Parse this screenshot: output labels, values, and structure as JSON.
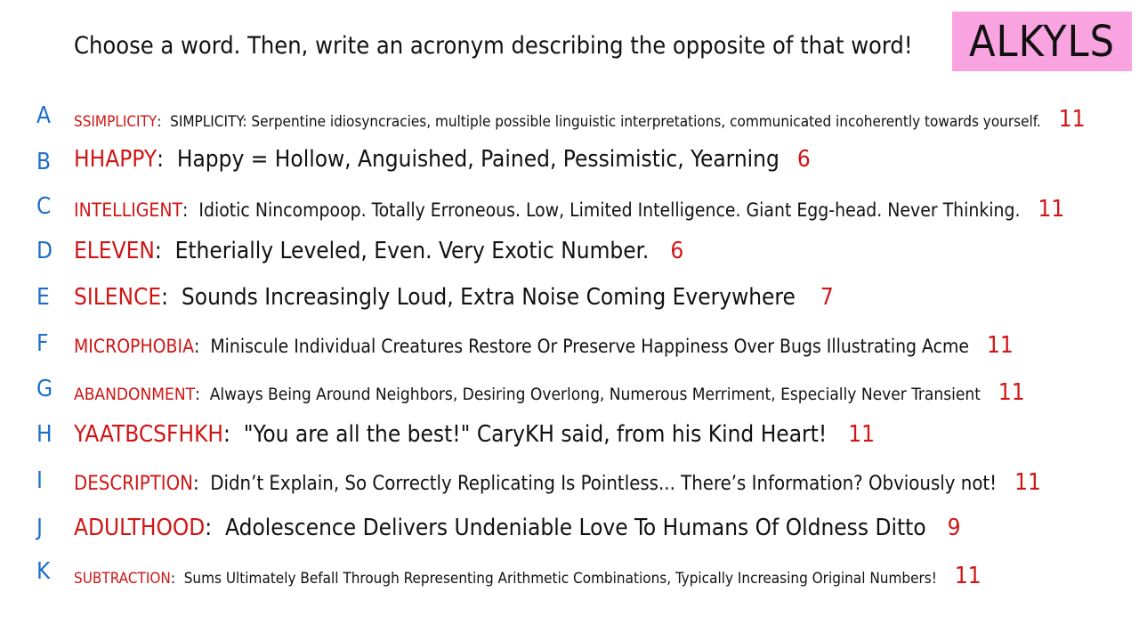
{
  "prompt": "Choose a word. Then, write an acronym describing the opposite of that word!",
  "badge": "ALKYLS",
  "entries": [
    {
      "letter": "A",
      "word": "SSIMPLICITY",
      "definition": "SIMPLICITY: Serpentine idiosyncracies, multiple possible linguistic interpretations, communicated incoherently towards yourself.",
      "count": "11"
    },
    {
      "letter": "B",
      "word": "HHAPPY",
      "definition": "Happy = Hollow, Anguished, Pained, Pessimistic, Yearning",
      "count": "6"
    },
    {
      "letter": "C",
      "word": "INTELLIGENT",
      "definition": "Idiotic Nincompoop. Totally Erroneous. Low, Limited Intelligence. Giant Egg-head. Never Thinking.",
      "count": "11"
    },
    {
      "letter": "D",
      "word": "ELEVEN",
      "definition": "Etherially Leveled, Even. Very Exotic Number.",
      "count": "6"
    },
    {
      "letter": "E",
      "word": "SILENCE",
      "definition": "Sounds Increasingly Loud, Extra Noise Coming Everywhere",
      "count": "7"
    },
    {
      "letter": "F",
      "word": "MICROPHOBIA",
      "definition": "Miniscule Individual Creatures Restore Or Preserve Happiness Over Bugs Illustrating Acme",
      "count": "11"
    },
    {
      "letter": "G",
      "word": "ABANDONMENT",
      "definition": "Always Being Around Neighbors, Desiring Overlong, Numerous Merriment, Especially Never Transient",
      "count": "11"
    },
    {
      "letter": "H",
      "word": "YAATBCSFHKH",
      "definition": "\"You are all the best!\" CaryKH said, from his Kind Heart!",
      "count": "11"
    },
    {
      "letter": "I",
      "word": "DESCRIPTION",
      "definition": "Didn’t Explain, So Correctly Replicating Is Pointless... There’s Information? Obviously not!",
      "count": "11"
    },
    {
      "letter": "J",
      "word": "ADULTHOOD",
      "definition": "Adolescence Delivers Undeniable Love To Humans Of Oldness Ditto",
      "count": "9"
    },
    {
      "letter": "K",
      "word": "SUBTRACTION",
      "definition": "Sums Ultimately Befall Through Representing Arithmetic Combinations, Typically Increasing Original Numbers!",
      "count": "11"
    }
  ],
  "colors": {
    "letter": "#1f6fc9",
    "word": "#d01515",
    "count": "#d01515",
    "badge_bg": "#f9a3e0"
  }
}
